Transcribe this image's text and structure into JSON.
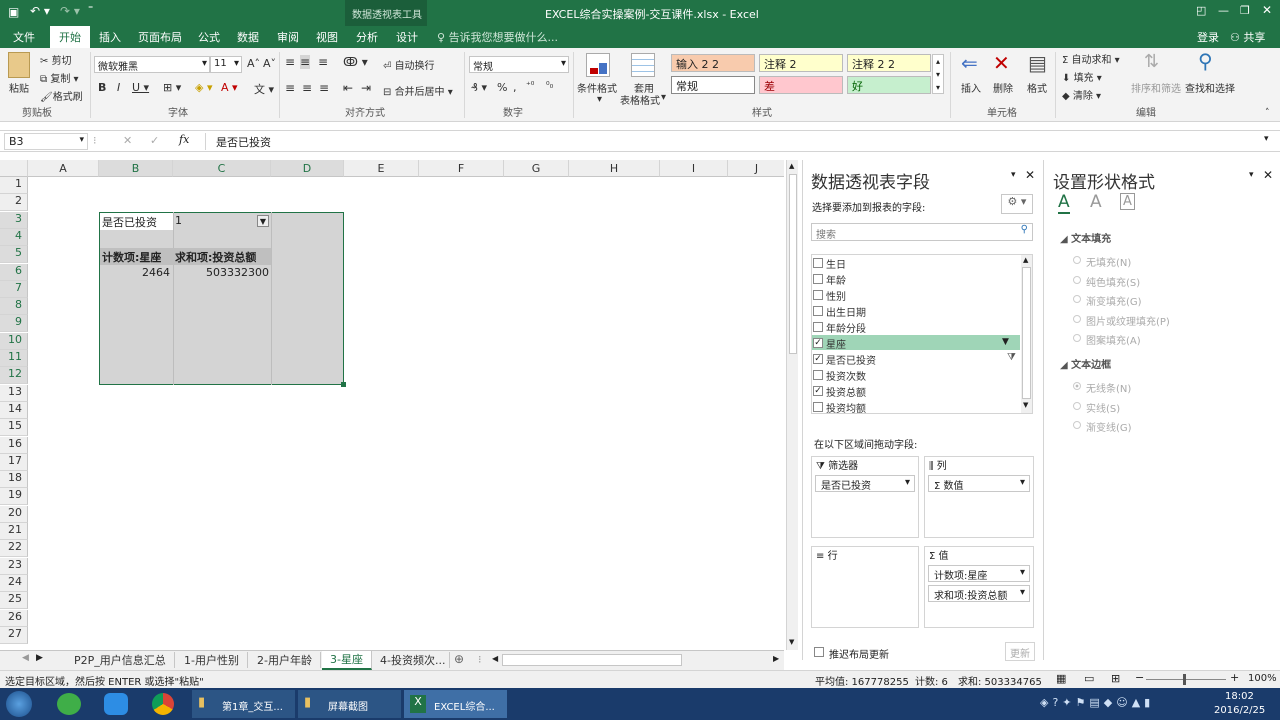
{
  "window": {
    "context_tool": "数据透视表工具",
    "title": "EXCEL综合实操案例-交互课件.xlsx - Excel"
  },
  "tabs": [
    "文件",
    "开始",
    "插入",
    "页面布局",
    "公式",
    "数据",
    "审阅",
    "视图",
    "分析",
    "设计"
  ],
  "tell_me": "告诉我您想要做什么...",
  "signin": "登录",
  "share": "共享",
  "ribbon": {
    "clipboard": {
      "paste": "粘贴",
      "cut": "剪切",
      "copy": "复制",
      "format_painter": "格式刷",
      "group": "剪贴板"
    },
    "font": {
      "name": "微软雅黑",
      "size": "11",
      "group": "字体"
    },
    "align": {
      "wrap": "自动换行",
      "merge": "合并后居中",
      "group": "对齐方式"
    },
    "number": {
      "format": "常规",
      "group": "数字"
    },
    "styles": {
      "cond": "条件格式",
      "table1": "套用",
      "table2": "表格格式",
      "group": "样式",
      "cells": [
        "输入 2 2",
        "注释 2",
        "注释 2 2",
        "常规",
        "差",
        "好"
      ]
    },
    "cells": {
      "insert": "插入",
      "delete": "删除",
      "format": "格式",
      "group": "单元格"
    },
    "editing": {
      "autosum": "自动求和",
      "fill": "填充",
      "clear": "清除",
      "sort": "排序和筛选",
      "find": "查找和选择",
      "group": "编辑"
    }
  },
  "namebox": "B3",
  "formula": "是否已投资",
  "columns": [
    "A",
    "B",
    "C",
    "D",
    "E",
    "F",
    "G",
    "H",
    "I",
    "J"
  ],
  "rows": [
    "1",
    "2",
    "3",
    "4",
    "5",
    "6",
    "7",
    "8",
    "9",
    "10",
    "11",
    "12",
    "13",
    "14",
    "15",
    "16",
    "17",
    "18",
    "19",
    "20",
    "21",
    "22",
    "23",
    "24",
    "25",
    "26",
    "27"
  ],
  "pivot": {
    "filter_label": "是否已投资",
    "filter_value": "1",
    "h1": "计数项:星座",
    "h2": "求和项:投资总额",
    "v1": "2464",
    "v2": "503332300"
  },
  "fields_pane": {
    "title": "数据透视表字段",
    "subtitle": "选择要添加到报表的字段:",
    "search": "搜索",
    "fields": [
      {
        "name": "生日",
        "checked": false
      },
      {
        "name": "年龄",
        "checked": false
      },
      {
        "name": "性别",
        "checked": false
      },
      {
        "name": "出生日期",
        "checked": false
      },
      {
        "name": "年龄分段",
        "checked": false
      },
      {
        "name": "星座",
        "checked": true
      },
      {
        "name": "是否已投资",
        "checked": true
      },
      {
        "name": "投资次数",
        "checked": false
      },
      {
        "name": "投资总额",
        "checked": true
      },
      {
        "name": "投资均额",
        "checked": false
      }
    ],
    "drag_hint": "在以下区域间拖动字段:",
    "filter_area": "筛选器",
    "filter_item": "是否已投资",
    "col_area": "列",
    "col_item": "Σ 数值",
    "row_area": "行",
    "val_area": "值",
    "val_items": [
      "计数项:星座",
      "求和项:投资总额"
    ],
    "defer": "推迟布局更新",
    "update": "更新"
  },
  "shape_pane": {
    "title": "设置形状格式",
    "fill_head": "文本填充",
    "fill_opts": [
      "无填充(N)",
      "纯色填充(S)",
      "渐变填充(G)",
      "图片或纹理填充(P)",
      "图案填充(A)"
    ],
    "border_head": "文本边框",
    "border_opts": [
      "无线条(N)",
      "实线(S)",
      "渐变线(G)"
    ]
  },
  "sheets": [
    "P2P_用户信息汇总",
    "1-用户性别",
    "2-用户年龄",
    "3-星座",
    "4-投资频次..."
  ],
  "status": {
    "left": "选定目标区域，然后按 ENTER 或选择\"粘贴\"",
    "avg": "平均值: 167778255",
    "count": "计数: 6",
    "sum": "求和: 503334765",
    "zoom": "100%"
  },
  "taskbar": {
    "items": [
      "第1章_交互...",
      "屏幕截图",
      "EXCEL综合..."
    ],
    "time": "18:02",
    "date": "2016/2/25"
  }
}
